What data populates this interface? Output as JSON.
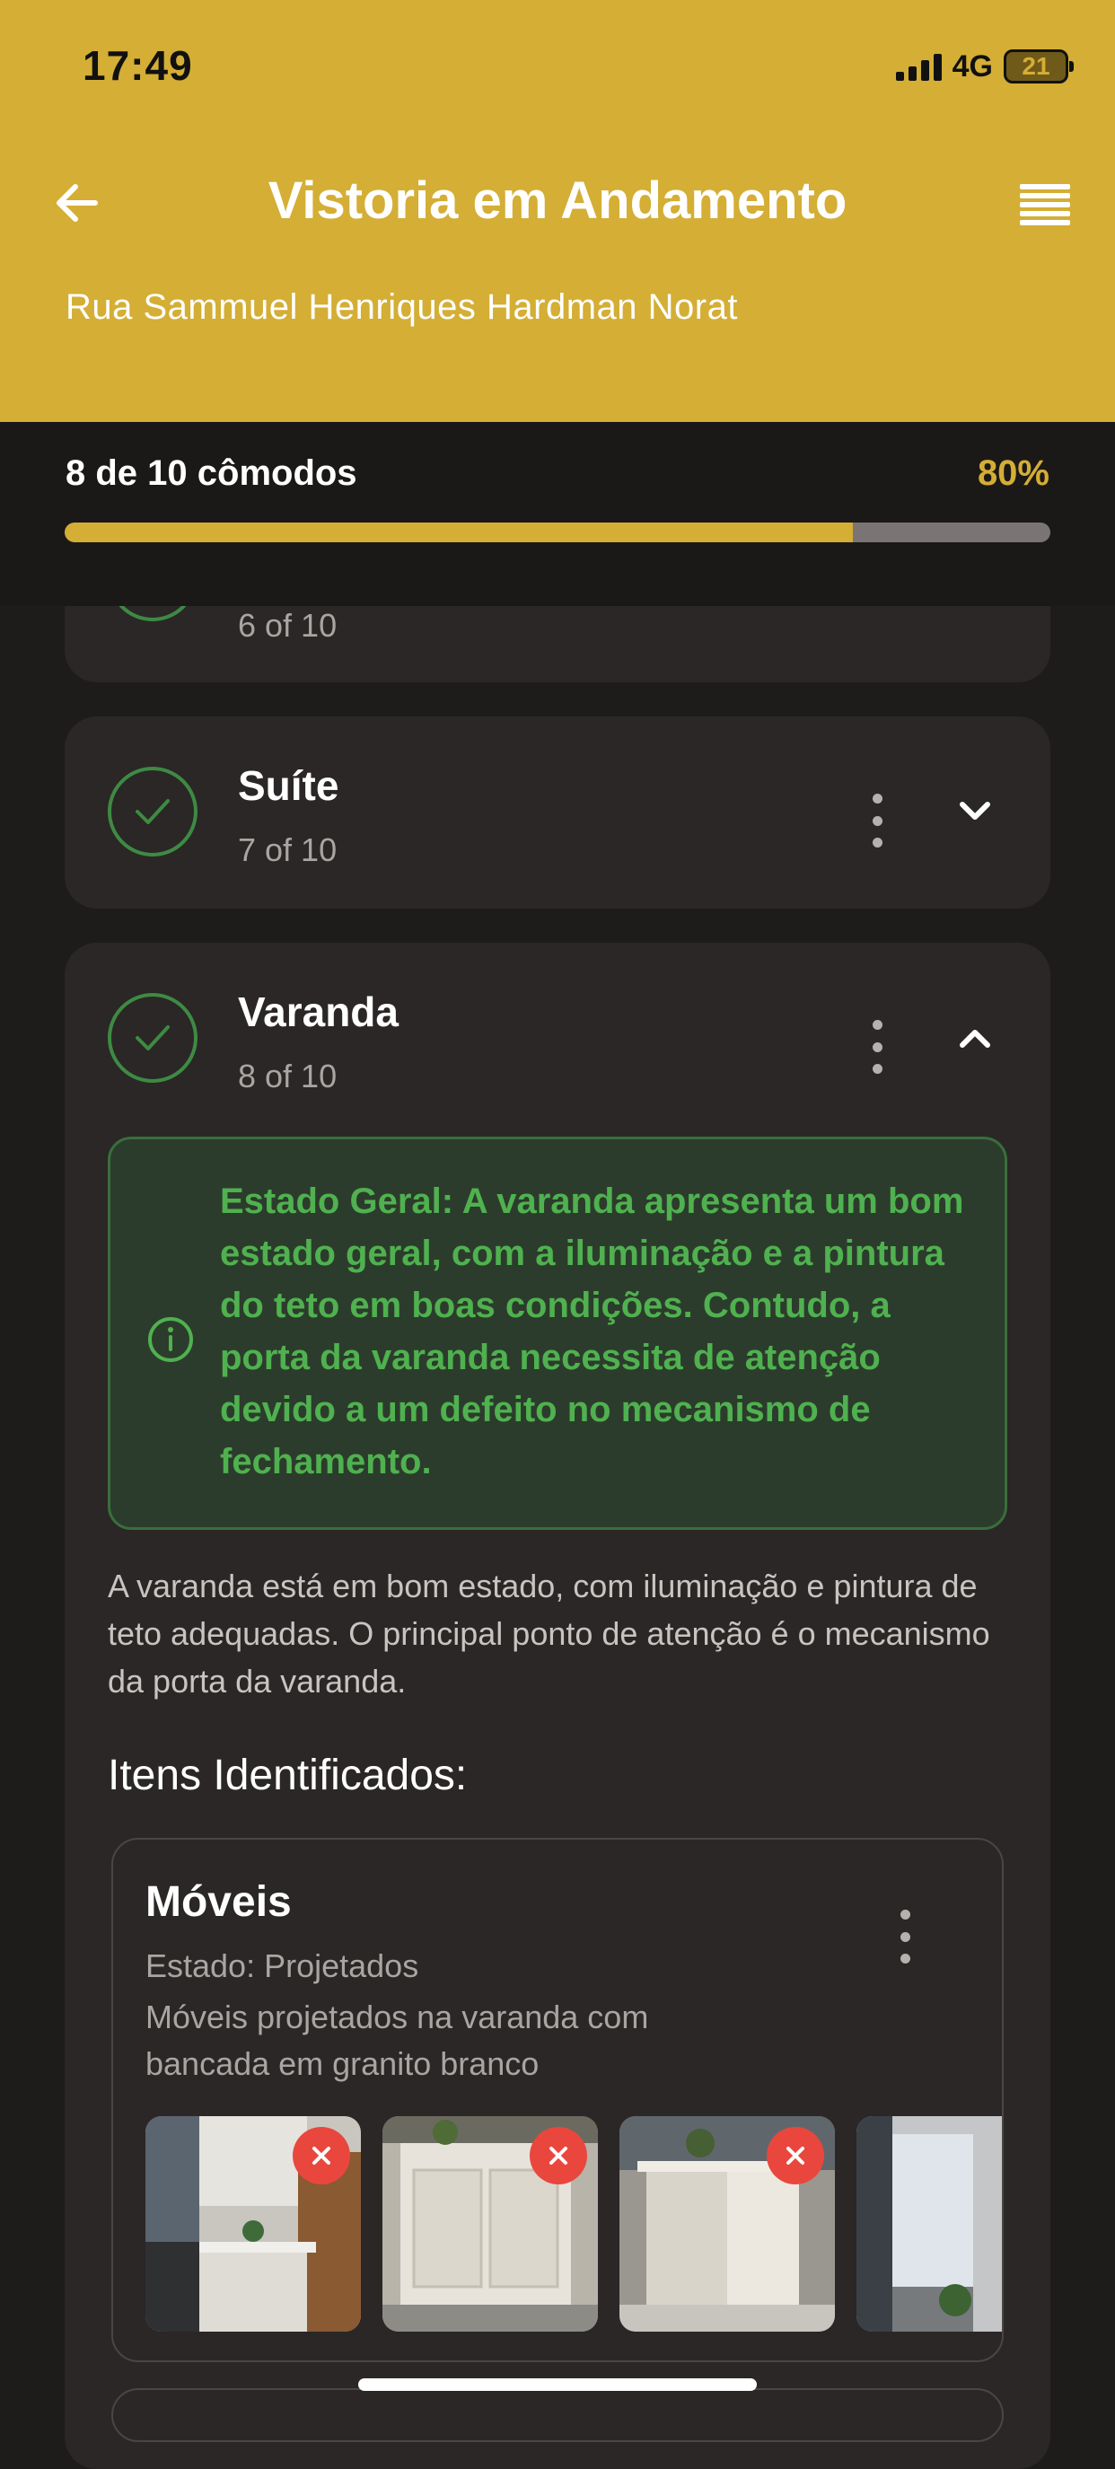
{
  "status_bar": {
    "time": "17:49",
    "network": "4G",
    "battery": "21"
  },
  "header": {
    "title": "Vistoria em Andamento",
    "address": "Rua Sammuel Henriques Hardman Norat"
  },
  "progress": {
    "label": "8 de 10 cômodos",
    "percent_label": "80%",
    "fraction": 0.8
  },
  "rooms": [
    {
      "name": "",
      "count": "6 of 10",
      "completed": true
    },
    {
      "name": "Suíte",
      "count": "7 of 10",
      "completed": true,
      "expanded": false
    },
    {
      "name": "Varanda",
      "count": "8 of 10",
      "completed": true,
      "expanded": true,
      "info": "Estado Geral: A varanda apresenta um bom estado geral, com a iluminação e a pintura do teto em boas condições. Contudo, a porta da varanda necessita de atenção devido a um defeito no mecanismo de fechamento.",
      "summary": "A varanda está em bom estado, com iluminação e pintura de teto adequadas. O principal ponto de atenção é o mecanismo da porta da varanda.",
      "items_title": "Itens Identificados:",
      "items": [
        {
          "title": "Móveis",
          "state": "Estado: Projetados",
          "description": "Móveis projetados na varanda com bancada em granito branco"
        }
      ]
    }
  ],
  "colors": {
    "accent": "#d4ae35",
    "success": "#4fb14f",
    "danger": "#e9473d",
    "background": "#1e1c1b",
    "card": "#2a2726"
  },
  "icons": [
    "back-arrow-icon",
    "menu-icon",
    "check-icon",
    "more-vertical-icon",
    "chevron-down-icon",
    "chevron-up-icon",
    "info-icon",
    "close-icon"
  ]
}
